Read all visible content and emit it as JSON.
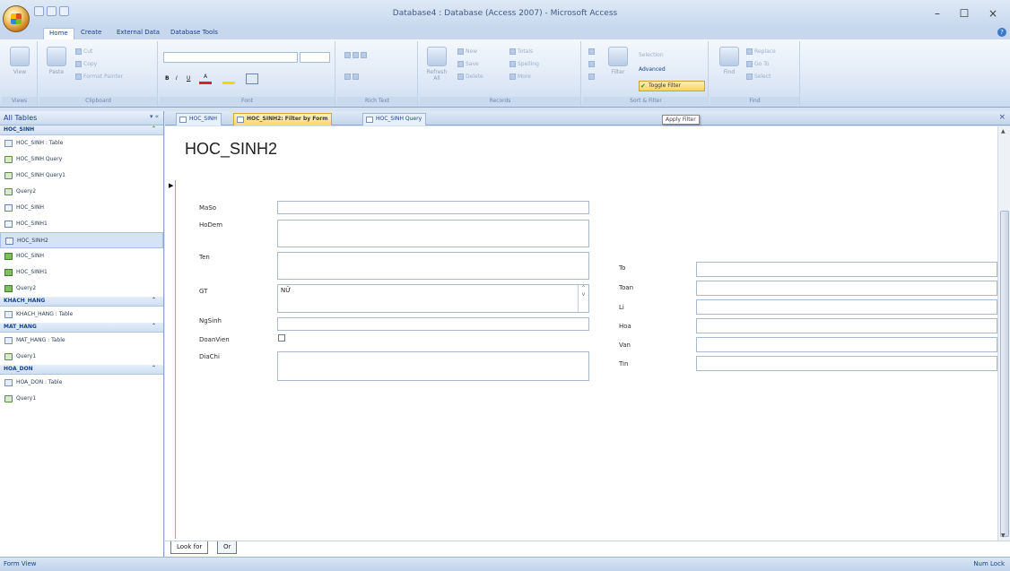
{
  "window": {
    "title": "Database4 : Database (Access 2007) - Microsoft Access",
    "minimize": "–",
    "maximize": "☐",
    "close": "×"
  },
  "ribbon_tabs": [
    "Home",
    "Create",
    "External Data",
    "Database Tools"
  ],
  "ribbon": {
    "groups": [
      "Views",
      "Clipboard",
      "Font",
      "Rich Text",
      "Records",
      "Sort & Filter",
      "Find"
    ],
    "view_label": "View",
    "paste_label": "Paste",
    "cut_label": "Cut",
    "copy_label": "Copy",
    "format_painter_label": "Format Painter",
    "refresh_label": "Refresh All",
    "new_label": "New",
    "save_label": "Save",
    "delete_label": "Delete",
    "totals_label": "Totals",
    "spelling_label": "Spelling",
    "more_label": "More",
    "filter_label": "Filter",
    "selection_label": "Selection",
    "advanced_label": "Advanced",
    "toggle_filter_label": "Toggle Filter",
    "find_label": "Find",
    "replace_label": "Replace",
    "goto_label": "Go To",
    "select_label": "Select"
  },
  "nav": {
    "header": "All Tables",
    "groups": [
      {
        "name": "HOC_SINH",
        "items": [
          {
            "label": "HOC_SINH : Table",
            "icon": "table"
          },
          {
            "label": "HOC_SINH Query",
            "icon": "query"
          },
          {
            "label": "HOC_SINH Query1",
            "icon": "query"
          },
          {
            "label": "Query2",
            "icon": "query"
          },
          {
            "label": "HOC_SINH",
            "icon": "form"
          },
          {
            "label": "HOC_SINH1",
            "icon": "form"
          },
          {
            "label": "HOC_SINH2",
            "icon": "form",
            "selected": true
          },
          {
            "label": "HOC_SINH",
            "icon": "report"
          },
          {
            "label": "HOC_SINH1",
            "icon": "report"
          },
          {
            "label": "Query2",
            "icon": "report"
          }
        ]
      },
      {
        "name": "KHACH_HANG",
        "items": [
          {
            "label": "KHACH_HANG : Table",
            "icon": "table"
          }
        ]
      },
      {
        "name": "MAT_HANG",
        "items": [
          {
            "label": "MAT_HANG : Table",
            "icon": "table"
          },
          {
            "label": "Query1",
            "icon": "query"
          }
        ]
      },
      {
        "name": "HOA_DON",
        "items": [
          {
            "label": "HOA_DON : Table",
            "icon": "table"
          },
          {
            "label": "Query1",
            "icon": "query"
          }
        ]
      }
    ]
  },
  "doc_tabs": [
    {
      "label": "HOC_SINH",
      "active": false
    },
    {
      "label": "HOC_SINH2: Filter by Form",
      "active": true
    },
    {
      "label": "HOC_SINH Query",
      "active": false
    }
  ],
  "tooltip": "Apply Filter",
  "form": {
    "title": "HOC_SINH2",
    "left_fields": {
      "maso": {
        "label": "MaSo",
        "value": ""
      },
      "hodem": {
        "label": "HoDem",
        "value": ""
      },
      "ten": {
        "label": "Ten",
        "value": ""
      },
      "gt": {
        "label": "GT",
        "value": "NỮ"
      },
      "ngsinh": {
        "label": "NgSinh",
        "value": ""
      },
      "doanvien": {
        "label": "DoanVien"
      },
      "diachi": {
        "label": "DiaChi",
        "value": ""
      }
    },
    "right_fields": [
      "To",
      "Toan",
      "Li",
      "Hoa",
      "Van",
      "Tin"
    ]
  },
  "bottom_tabs": [
    "Look for",
    "Or"
  ],
  "status": {
    "left": "Form View",
    "right": "Num Lock"
  }
}
